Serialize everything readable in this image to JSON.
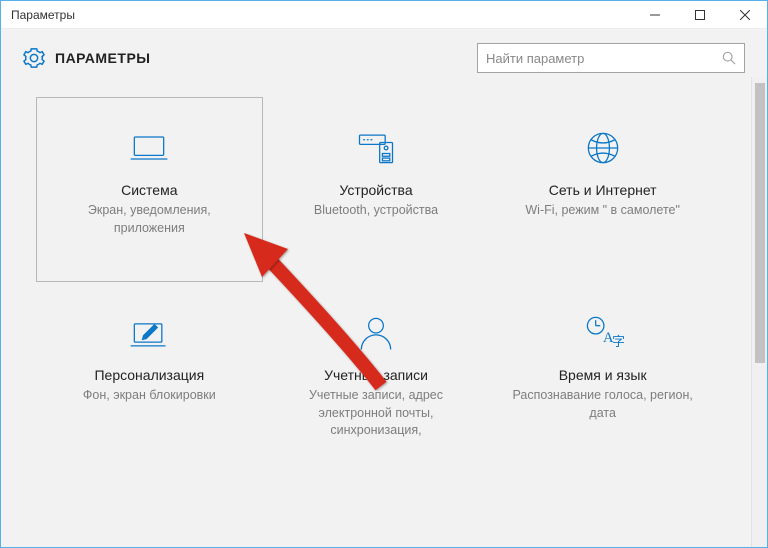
{
  "window": {
    "title": "Параметры"
  },
  "header": {
    "title": "ПАРАМЕТРЫ"
  },
  "search": {
    "placeholder": "Найти параметр"
  },
  "tiles": [
    {
      "title": "Система",
      "desc": "Экран, уведомления, приложения"
    },
    {
      "title": "Устройства",
      "desc": "Bluetooth, устройства"
    },
    {
      "title": "Сеть и Интернет",
      "desc": "Wi-Fi, режим \" в самолете\""
    },
    {
      "title": "Персонализация",
      "desc": "Фон, экран блокировки"
    },
    {
      "title": "Учетные записи",
      "desc": "Учетные записи, адрес электронной почты, синхронизация,"
    },
    {
      "title": "Время и язык",
      "desc": "Распознавание голоса, регион, дата"
    }
  ]
}
